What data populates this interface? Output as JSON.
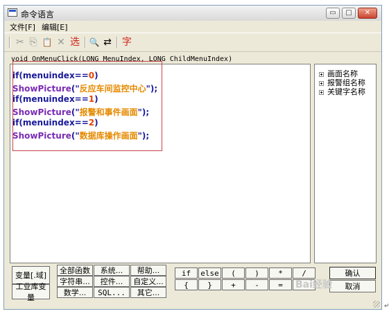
{
  "window": {
    "title": "命令语言",
    "controls": {
      "minimize": "▭",
      "maximize": "□",
      "close": "✕"
    }
  },
  "menu": [
    "文件[F]",
    "编辑[E]"
  ],
  "toolbar": {
    "items": [
      {
        "name": "cut-icon",
        "glyph": "✂"
      },
      {
        "name": "copy-icon",
        "glyph": "⎘"
      },
      {
        "name": "paste-icon",
        "glyph": "📋"
      },
      {
        "name": "delete-icon",
        "glyph": "✕"
      },
      {
        "name": "select-icon",
        "glyph": "选"
      },
      {
        "name": "find-icon",
        "glyph": "🔍"
      },
      {
        "name": "replace-icon",
        "glyph": "⇄"
      },
      {
        "name": "font-icon",
        "glyph": "字"
      }
    ]
  },
  "signature": "void OnMenuClick(LONG MenuIndex, LONG ChildMenuIndex)",
  "code": [
    {
      "kw": "if",
      "pre": "(menuindex==",
      "num": "0",
      "post": ")"
    },
    {
      "fn": "ShowPicture",
      "open": "(\"",
      "str": "反应车间监控中心",
      "close": "\");"
    },
    {
      "kw": "if",
      "pre": "(menuindex==",
      "num": "1",
      "post": ")"
    },
    {
      "fn": "ShowPicture",
      "open": "(\"",
      "str": "报警和事件画面",
      "close": "\");"
    },
    {
      "kw": "if",
      "pre": "(menuindex==",
      "num": "2",
      "post": ")"
    },
    {
      "fn": "ShowPicture",
      "open": "(\"",
      "str": "数据库操作画面",
      "close": "\");"
    }
  ],
  "tree": [
    "画面名称",
    "报警组名称",
    "关键字名称"
  ],
  "buttons": {
    "variable": "变量[.域]",
    "industrial_var": "工业库变量",
    "all_funcs": "全部函数",
    "system": "系统...",
    "help": "帮助...",
    "string": "字符串...",
    "control": "控件...",
    "custom": "自定义...",
    "math": "数学...",
    "sql": "SQL...",
    "other": "其它...",
    "ops_row1": [
      "if",
      "else",
      "(",
      ")",
      "*",
      "/"
    ],
    "ops_row2": [
      "{",
      "}",
      "+",
      "-",
      "=",
      ""
    ],
    "ok": "确认",
    "cancel": "取消"
  },
  "watermark": "Bai经验",
  "corner_mark": "↵"
}
